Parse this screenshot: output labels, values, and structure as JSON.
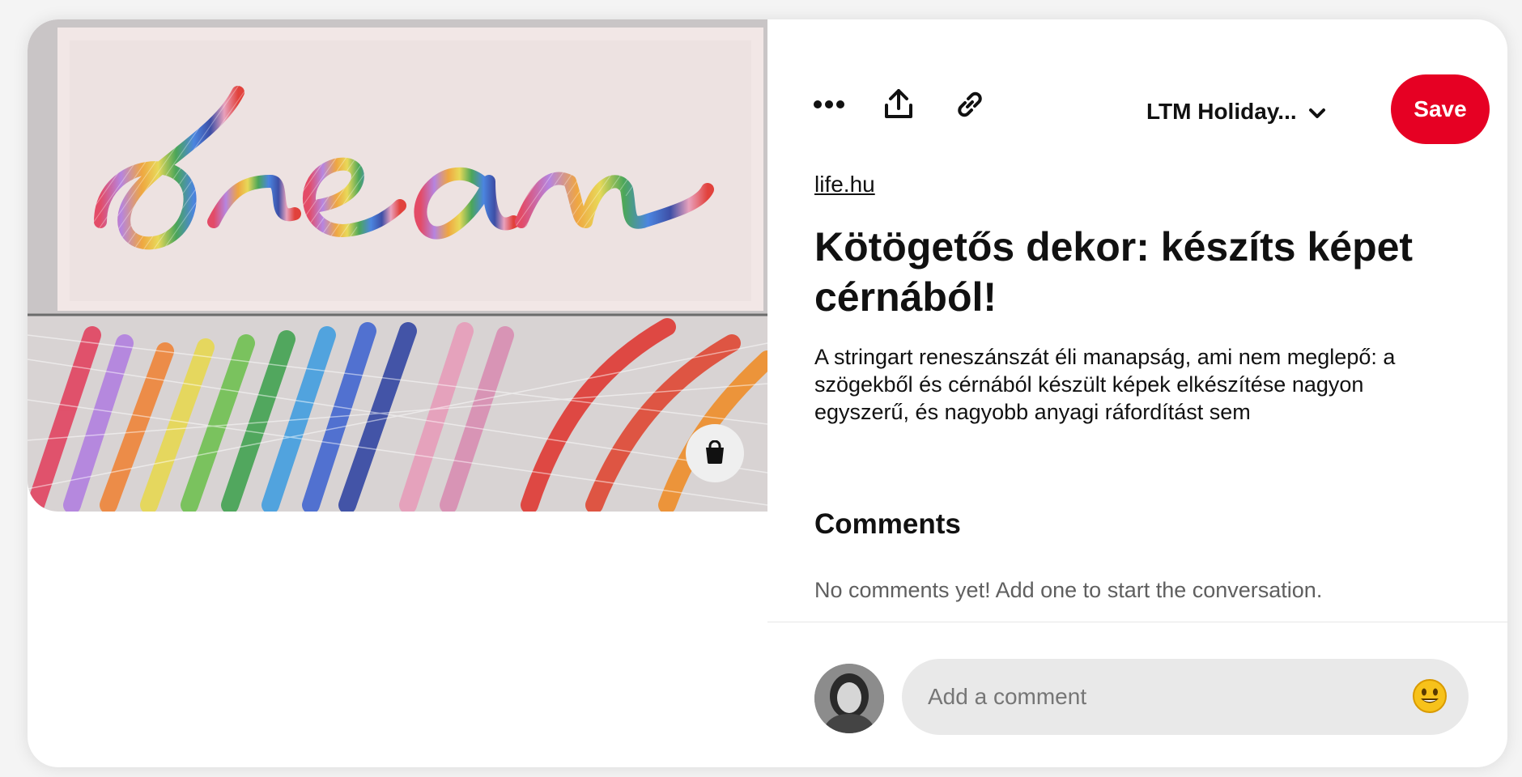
{
  "pin": {
    "image_alt": "dream",
    "bag_icon": "shopping-bag-icon"
  },
  "toolbar": {
    "more_icon": "more-dots-icon",
    "share_icon": "share-upload-icon",
    "link_icon": "link-icon",
    "board_name": "LTM Holiday...",
    "board_chevron_icon": "chevron-down-icon",
    "save_label": "Save",
    "save_color": "#e60023"
  },
  "detail": {
    "source": "life.hu",
    "title": "Kötögetős dekor: készíts képet cérnából!",
    "description": "A stringart reneszánszát éli manapság, ami nem meglepő: a szögekből és cérnából készült képek elkészítése nagyon egyszerű, és nagyobb anyagi ráfordítást sem"
  },
  "comments": {
    "heading": "Comments",
    "empty_text": "No comments yet! Add one to start the conversation.",
    "input_placeholder": "Add a comment",
    "emoji_icon": "smiley-emoji-icon",
    "avatar_icon": "user-avatar"
  }
}
